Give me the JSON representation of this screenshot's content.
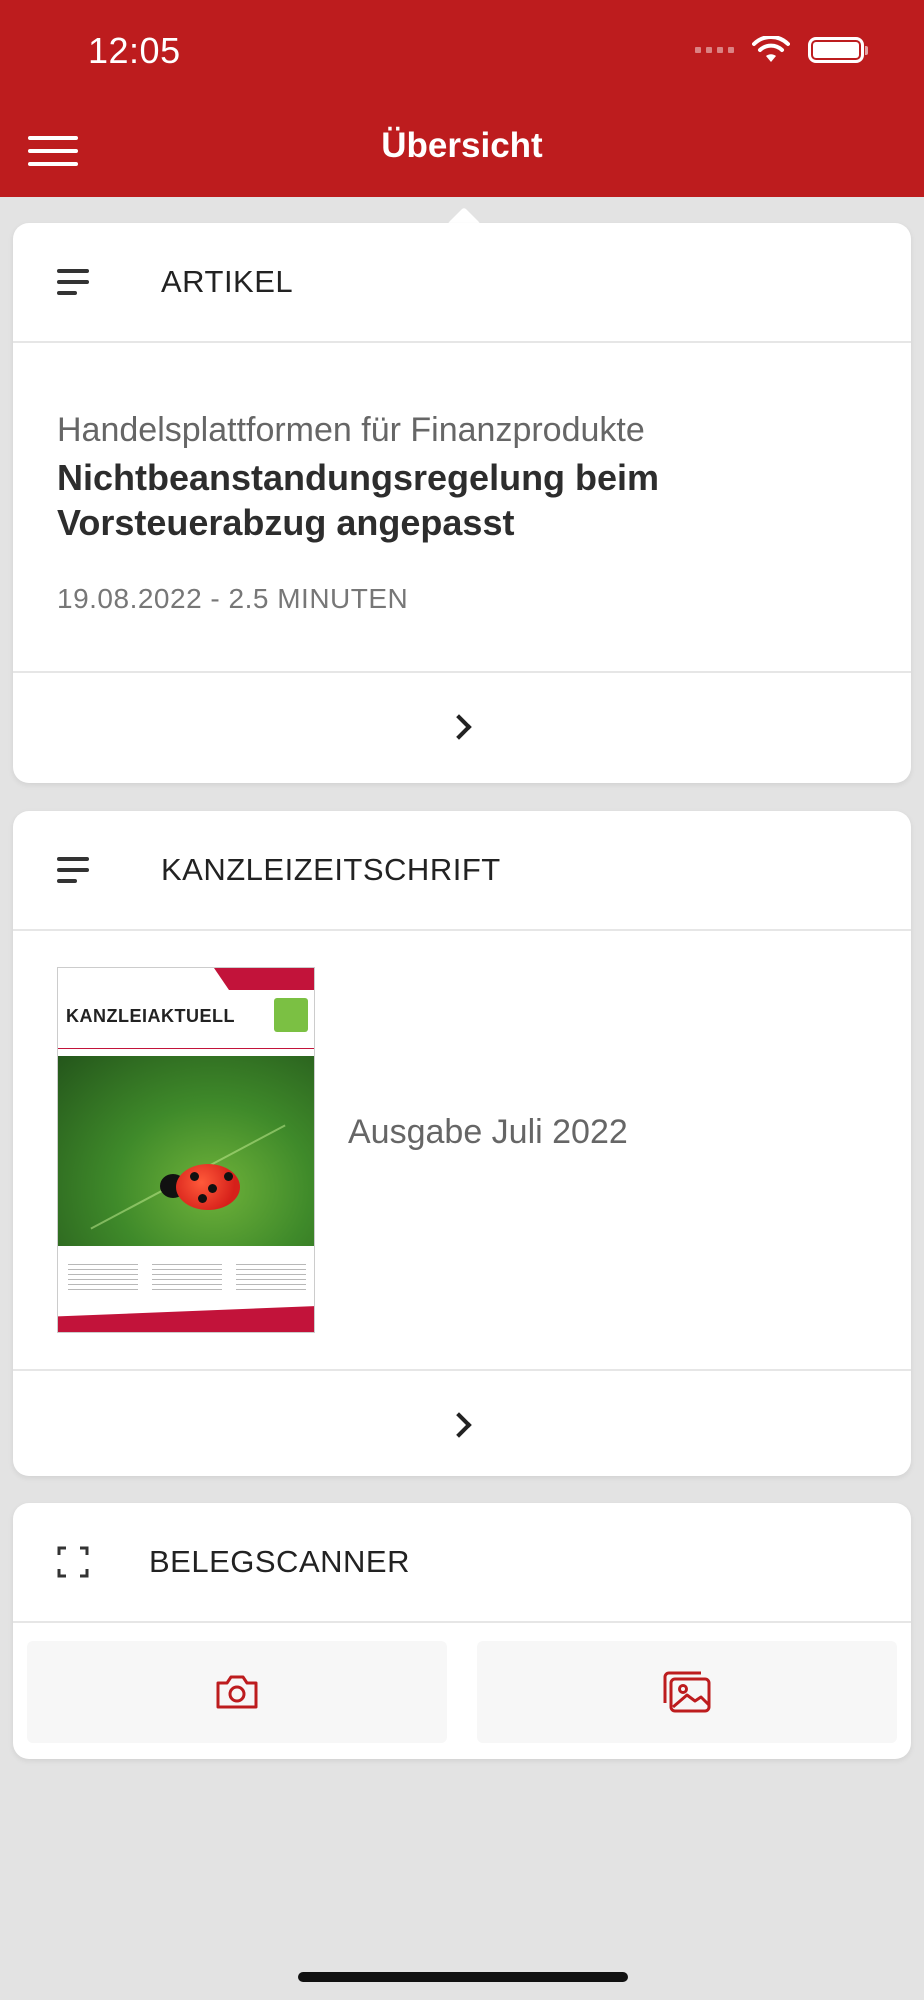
{
  "status_bar": {
    "time": "12:05"
  },
  "nav": {
    "title": "Übersicht"
  },
  "article_card": {
    "header": "ARTIKEL",
    "kicker": "Handelsplattformen für Finanzprodukte",
    "headline": "Nichtbeanstandungsregelung beim Vorsteuerabzug angepasst",
    "meta": "19.08.2022 - 2.5 MINUTEN"
  },
  "magazine_card": {
    "header": "KANZLEIZEITSCHRIFT",
    "cover_logo": "KANZLEIAKTUELL",
    "issue": "Ausgabe Juli 2022"
  },
  "scanner_card": {
    "header": "BELEGSCANNER",
    "actions": [
      {
        "icon": "camera-icon"
      },
      {
        "icon": "gallery-icon"
      }
    ]
  },
  "colors": {
    "brand_red": "#bd1c1e",
    "background": "#e3e3e3",
    "card": "#ffffff"
  }
}
